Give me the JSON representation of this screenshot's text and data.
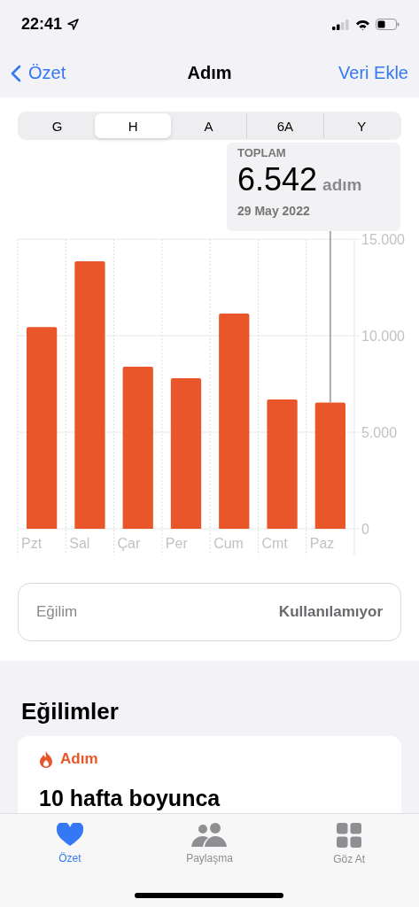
{
  "status_bar": {
    "time": "22:41"
  },
  "nav": {
    "back": "Özet",
    "title": "Adım",
    "action": "Veri Ekle"
  },
  "ranges": [
    {
      "label": "G",
      "selected": false
    },
    {
      "label": "H",
      "selected": true
    },
    {
      "label": "A",
      "selected": false
    },
    {
      "label": "6A",
      "selected": false
    },
    {
      "label": "Y",
      "selected": false
    }
  ],
  "tooltip": {
    "label": "TOPLAM",
    "value": "6.542",
    "unit": "adım",
    "date": "29 May 2022"
  },
  "chart_data": {
    "type": "bar",
    "categories": [
      "Pzt",
      "Sal",
      "Çar",
      "Per",
      "Cum",
      "Cmt",
      "Paz"
    ],
    "series": [
      {
        "color": "#e8562a",
        "values": [
          10450,
          13850,
          8400,
          7800,
          11150,
          6700,
          6542
        ]
      }
    ],
    "ylim": [
      0,
      15000
    ],
    "yticks": [
      {
        "value": 0,
        "label": "0"
      },
      {
        "value": 5000,
        "label": "5.000"
      },
      {
        "value": 10000,
        "label": "10.000"
      },
      {
        "value": 15000,
        "label": "15.000"
      }
    ]
  },
  "trend": {
    "label": "Eğilim",
    "value": "Kullanılamıyor"
  },
  "trends_section": {
    "title": "Eğilimler",
    "card": {
      "category": "Adım",
      "headline": "10 hafta boyunca"
    }
  },
  "tab_bar": [
    {
      "label": "Özet",
      "kind": "heart",
      "selected": true
    },
    {
      "label": "Paylaşma",
      "kind": "people",
      "selected": false
    },
    {
      "label": "Göz At",
      "kind": "grid",
      "selected": false
    }
  ]
}
